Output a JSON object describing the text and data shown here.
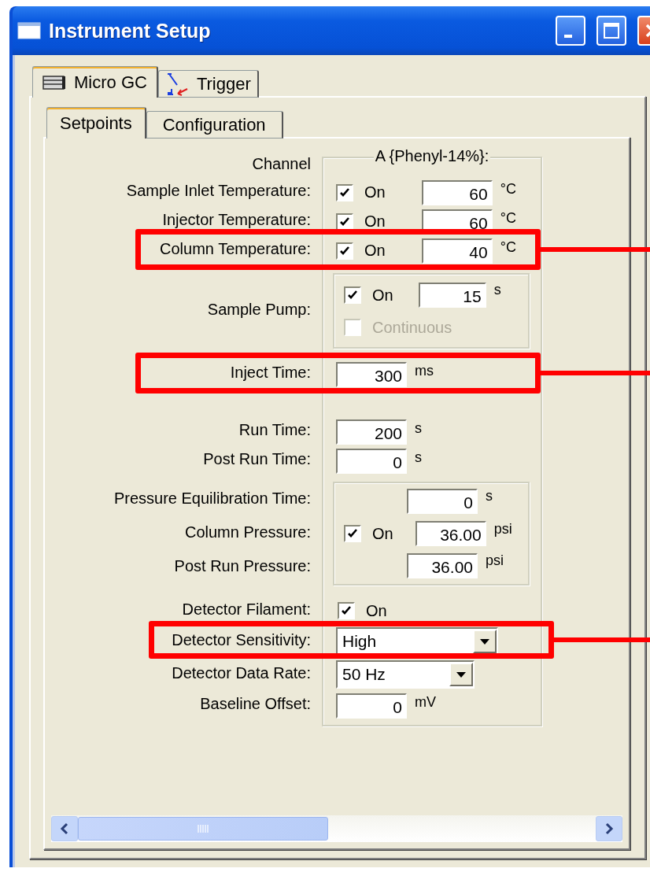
{
  "window": {
    "title": "Instrument Setup"
  },
  "tabs": [
    {
      "label": "Micro GC",
      "kind": "gc",
      "selected": true
    },
    {
      "label": "Trigger",
      "kind": "trigger",
      "selected": false
    }
  ],
  "subtabs": [
    {
      "label": "Setpoints",
      "selected": true
    },
    {
      "label": "Configuration",
      "selected": false
    }
  ],
  "channel": {
    "label": "Channel",
    "name": "A {Phenyl-14%}:"
  },
  "sections": [
    {
      "rows": [
        {
          "kind": "temp",
          "label": "Sample Inlet Temperature:",
          "checked": true,
          "on_label": "On",
          "value": "60",
          "unit": "°C",
          "highlighted": false
        },
        {
          "kind": "temp",
          "label": "Injector Temperature:",
          "checked": true,
          "on_label": "On",
          "value": "60",
          "unit": "°C",
          "highlighted": false
        },
        {
          "kind": "temp",
          "label": "Column Temperature:",
          "checked": true,
          "on_label": "On",
          "value": "40",
          "unit": "°C",
          "highlighted": true
        }
      ]
    },
    {
      "rows": [
        {
          "kind": "pump",
          "label": "Sample Pump:",
          "checked": true,
          "on_label": "On",
          "value": "15",
          "unit": "s",
          "continuous": {
            "label": "Continuous",
            "checked": false,
            "disabled": true
          },
          "highlighted": false
        }
      ]
    },
    {
      "rows": [
        {
          "kind": "time",
          "label": "Inject Time:",
          "value": "300",
          "unit": "ms",
          "highlighted": true
        }
      ]
    },
    {
      "rows": [
        {
          "kind": "time",
          "label": "Run Time:",
          "value": "200",
          "unit": "s",
          "highlighted": false
        },
        {
          "kind": "time",
          "label": "Post Run Time:",
          "value": "0",
          "unit": "s",
          "highlighted": false
        }
      ]
    },
    {
      "rows": [
        {
          "kind": "pressure",
          "highlighted": false,
          "items": [
            {
              "label": "Pressure Equilibration Time:",
              "value": "0",
              "unit": "s"
            },
            {
              "label": "Column Pressure:",
              "checked": true,
              "on_label": "On",
              "value": "36.00",
              "unit": "psi"
            },
            {
              "label": "Post Run Pressure:",
              "value": "36.00",
              "unit": "psi"
            }
          ]
        }
      ]
    },
    {
      "rows": [
        {
          "kind": "check",
          "label": "Detector Filament:",
          "checked": true,
          "on_label": "On",
          "highlighted": false
        },
        {
          "kind": "dropdown",
          "label": "Detector Sensitivity:",
          "value": "High",
          "highlighted": true
        },
        {
          "kind": "dropdown",
          "label": "Detector Data Rate:",
          "value": "50 Hz",
          "highlighted": false
        },
        {
          "kind": "time",
          "label": "Baseline Offset:",
          "value": "0",
          "unit": "mV",
          "highlighted": false
        }
      ]
    }
  ]
}
